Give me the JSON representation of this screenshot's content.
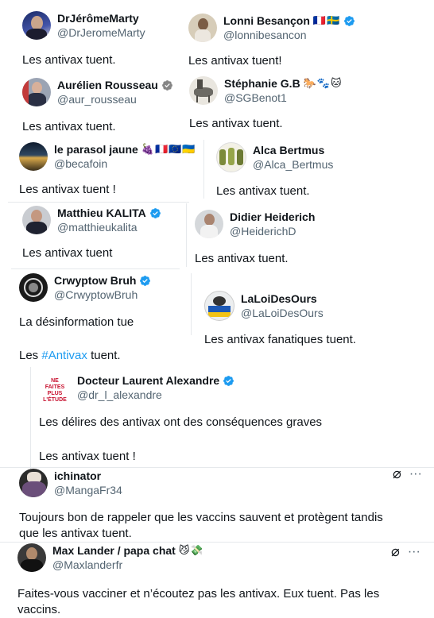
{
  "tweets": [
    {
      "name": "DrJérômeMarty",
      "handle": "@DrJeromeMarty",
      "text": "Les antivax tuent."
    },
    {
      "name": "Lonni Besançon",
      "handle": "@lonnibesancon",
      "text": "Les antivax tuent!",
      "emoji": "🇫🇷🇸🇪"
    },
    {
      "name": "Aurélien Rousseau",
      "handle": "@aur_rousseau",
      "text": "Les antivax tuent."
    },
    {
      "name": "Stéphanie G.B",
      "handle": "@SGBenot1",
      "text": "Les antivax tuent.",
      "emoji": "🐎🐾🐱"
    },
    {
      "name": "le parasol jaune",
      "handle": "@becafoin",
      "text": "Les antivax tuent !",
      "emoji": "🍇🇫🇷🇪🇺🇺🇦"
    },
    {
      "name": "Alca Bertmus",
      "handle": "@Alca_Bertmus",
      "text": "Les antivax tuent."
    },
    {
      "name": "Matthieu KALITA",
      "handle": "@matthieukalita",
      "text": "Les antivax tuent"
    },
    {
      "name": "Didier Heiderich",
      "handle": "@HeiderichD",
      "text": "Les antivax tuent."
    },
    {
      "name": "Crwyptow Bruh",
      "handle": "@CrwyptowBruh",
      "text": "La désinformation tue"
    },
    {
      "name": "LaLoiDesOurs",
      "handle": "@LaLoiDesOurs",
      "text": "Les antivax fanatiques tuent."
    }
  ],
  "crwyptow_extra": {
    "prefix": "Les ",
    "hashtag": "#Antivax",
    "suffix": " tuent."
  },
  "quote": {
    "name": "Docteur Laurent Alexandre",
    "handle": "@dr_l_alexandre",
    "line1": "Les délires des antivax ont des conséquences graves",
    "line2": "Les antivax tuent !",
    "avatar_text": "NE FAITES PLUS L'ÉTUDE"
  },
  "ichinator": {
    "name": "ichinator",
    "handle": "@MangaFr34",
    "text1": "Toujours bon de rappeler que les vaccins sauvent et protègent tandis",
    "text2": "que les antivax tuent.",
    "more": "···",
    "grok": "⌀"
  },
  "maxlander": {
    "name": "Max Lander / papa chat",
    "emoji": "😼💸",
    "handle": "@Maxlanderfr",
    "text1": "Faites-vous vacciner et n’écoutez pas les antivax. Eux tuent. Pas les",
    "text2": "vaccins.",
    "more": "···",
    "grok": "⌀"
  },
  "colors": {
    "link": "#1d9bf0",
    "secondary": "#536471",
    "text": "#0f1419",
    "verified": "#1d9bf0"
  }
}
